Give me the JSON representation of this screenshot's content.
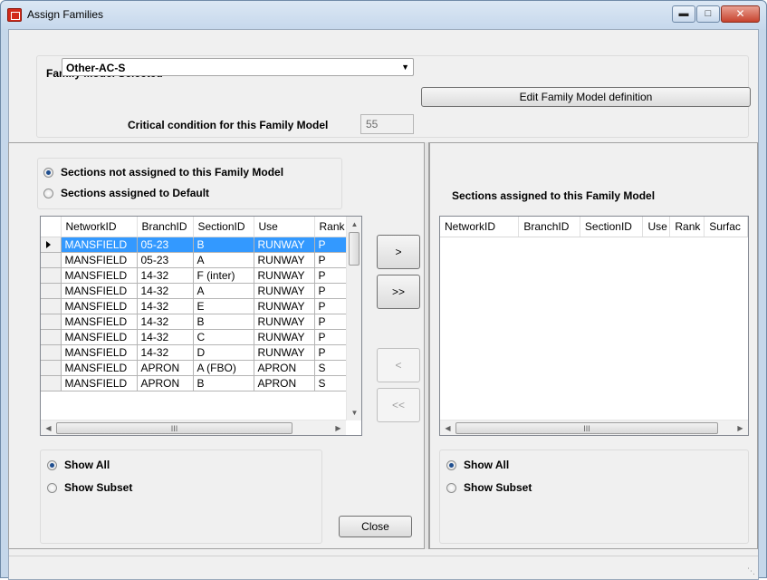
{
  "window": {
    "title": "Assign Families"
  },
  "family": {
    "group_label": "Family Model Selected",
    "selected": "Other-AC-S",
    "edit_button": "Edit Family Model definition",
    "critical_label": "Critical condition for this Family Model",
    "critical_value": "55"
  },
  "left": {
    "radio_not_assigned": "Sections not assigned to this Family Model",
    "radio_default": "Sections assigned to Default",
    "columns": [
      "NetworkID",
      "BranchID",
      "SectionID",
      "Use",
      "Rank"
    ],
    "rows": [
      [
        "MANSFIELD",
        "05-23",
        "B",
        "RUNWAY",
        "P"
      ],
      [
        "MANSFIELD",
        "05-23",
        "A",
        "RUNWAY",
        "P"
      ],
      [
        "MANSFIELD",
        "14-32",
        "F (inter)",
        "RUNWAY",
        "P"
      ],
      [
        "MANSFIELD",
        "14-32",
        "A",
        "RUNWAY",
        "P"
      ],
      [
        "MANSFIELD",
        "14-32",
        "E",
        "RUNWAY",
        "P"
      ],
      [
        "MANSFIELD",
        "14-32",
        "B",
        "RUNWAY",
        "P"
      ],
      [
        "MANSFIELD",
        "14-32",
        "C",
        "RUNWAY",
        "P"
      ],
      [
        "MANSFIELD",
        "14-32",
        "D",
        "RUNWAY",
        "P"
      ],
      [
        "MANSFIELD",
        "APRON",
        "A (FBO)",
        "APRON",
        "S"
      ],
      [
        "MANSFIELD",
        "APRON",
        "B",
        "APRON",
        "S"
      ]
    ],
    "show_all": "Show All",
    "show_subset": "Show Subset",
    "close_button": "Close"
  },
  "transfer": {
    "move_one": ">",
    "move_all": ">>",
    "back_one": "<",
    "back_all": "<<"
  },
  "right": {
    "title": "Sections assigned to this Family Model",
    "columns": [
      "NetworkID",
      "BranchID",
      "SectionID",
      "Use",
      "Rank",
      "Surfac"
    ],
    "show_all": "Show All",
    "show_subset": "Show Subset"
  },
  "scroll": {
    "hthumb_glyph": "III"
  }
}
